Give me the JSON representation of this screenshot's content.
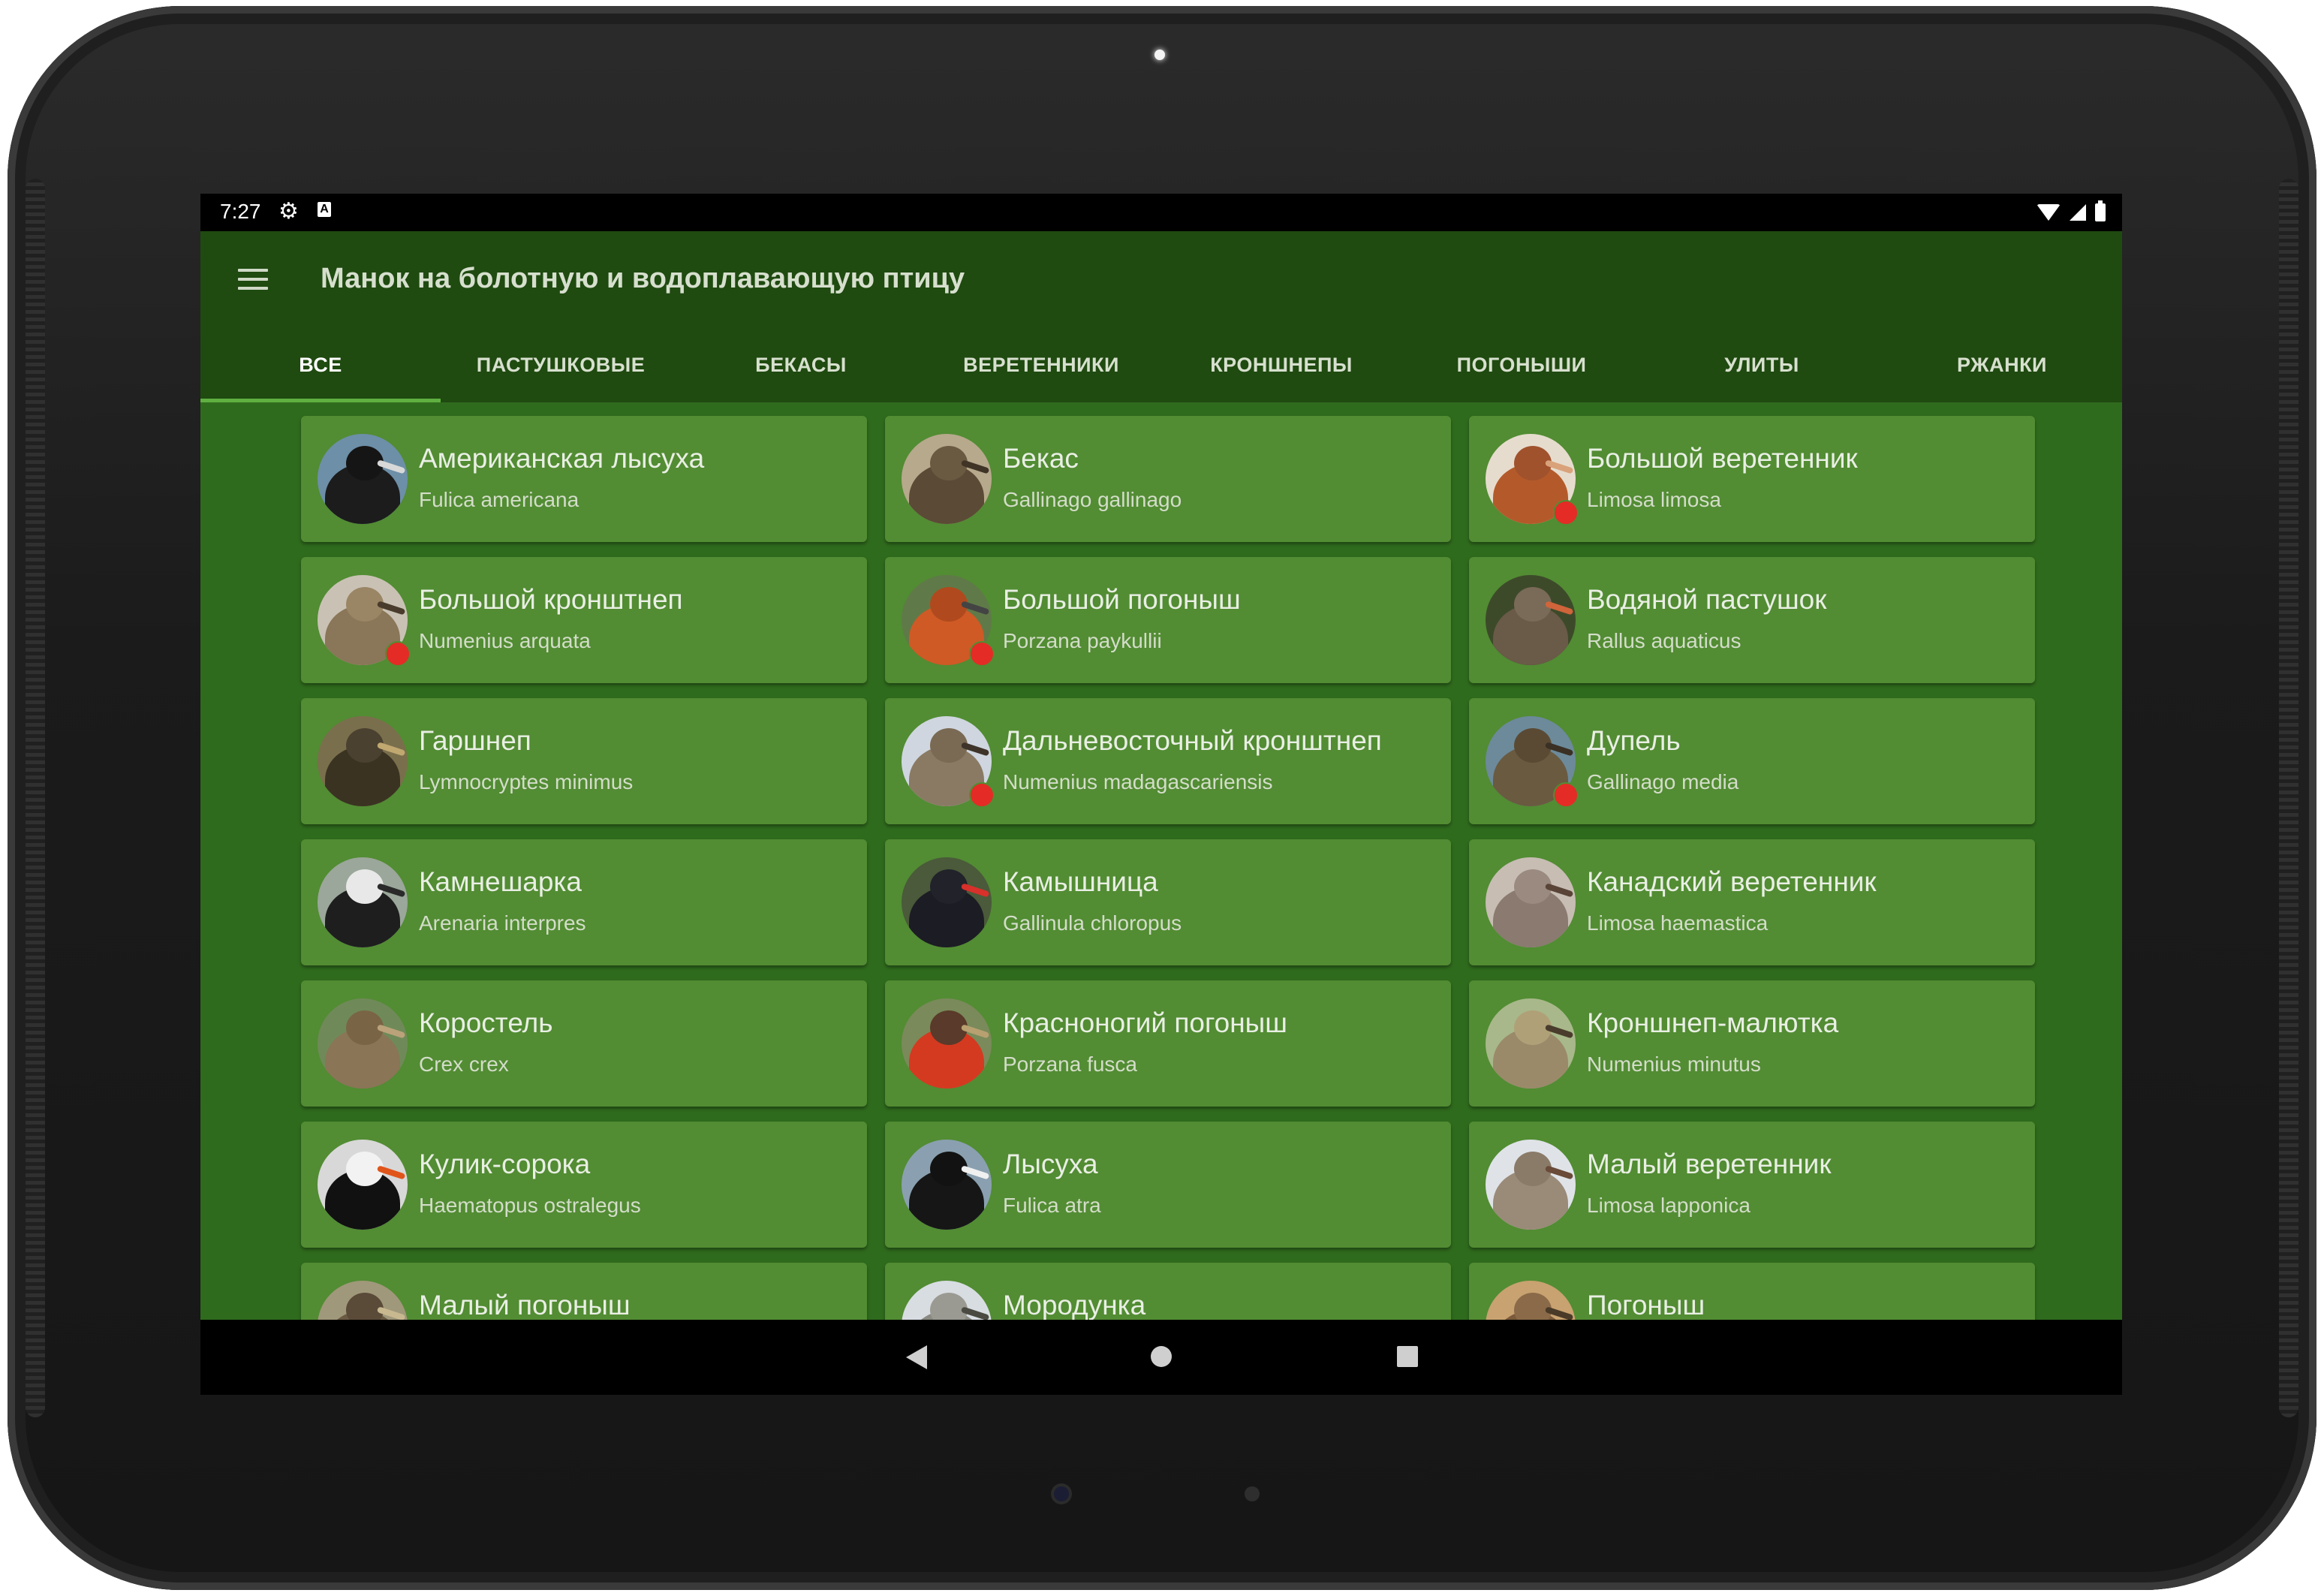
{
  "status": {
    "time": "7:27"
  },
  "app": {
    "title": "Манок на болотную и водоплавающую птицу"
  },
  "tabs": [
    {
      "label": "ВСЕ"
    },
    {
      "label": "ПАСТУШКОВЫЕ"
    },
    {
      "label": "БЕКАСЫ"
    },
    {
      "label": "ВЕРЕТЕННИКИ"
    },
    {
      "label": "КРОНШНЕПЫ"
    },
    {
      "label": "ПОГОНЫШИ"
    },
    {
      "label": "УЛИТЫ"
    },
    {
      "label": "РЖАНКИ"
    }
  ],
  "birds": [
    {
      "name": "Американская лысуха",
      "latin": "Fulica americana",
      "marked": false,
      "colors": [
        "#6d8fa8",
        "#1c1c1c",
        "#151515",
        "#d8d8d8"
      ]
    },
    {
      "name": "Бекас",
      "latin": "Gallinago gallinago",
      "marked": false,
      "colors": [
        "#b7a98c",
        "#5b4a36",
        "#6b5a42",
        "#3f3426"
      ]
    },
    {
      "name": "Большой веретенник",
      "latin": "Limosa limosa",
      "marked": true,
      "colors": [
        "#e6dccd",
        "#b45a2a",
        "#a0522d",
        "#d9a27a"
      ]
    },
    {
      "name": "Большой кронштнеп",
      "latin": "Numenius arquata",
      "marked": true,
      "colors": [
        "#c9c2b4",
        "#8a7658",
        "#9a8565",
        "#4a3c2c"
      ]
    },
    {
      "name": "Большой погоныш",
      "latin": "Porzana paykullii",
      "marked": true,
      "colors": [
        "#5f7a48",
        "#cf5a25",
        "#b04a1e",
        "#444444"
      ]
    },
    {
      "name": "Водяной пастушок",
      "latin": "Rallus aquaticus",
      "marked": false,
      "colors": [
        "#3d4a2a",
        "#6a5a48",
        "#7a6a58",
        "#d0643a"
      ]
    },
    {
      "name": "Гаршнеп",
      "latin": "Lymnocryptes minimus",
      "marked": false,
      "colors": [
        "#7a6f4c",
        "#3a3322",
        "#4a4130",
        "#c0a870"
      ]
    },
    {
      "name": "Дальневосточный кронштнеп",
      "latin": "Numenius madagascariensis",
      "marked": true,
      "colors": [
        "#cfd6df",
        "#8a7a64",
        "#7a6a54",
        "#3e342a"
      ]
    },
    {
      "name": "Дупель",
      "latin": "Gallinago media",
      "marked": true,
      "colors": [
        "#6c8a9a",
        "#6a5a40",
        "#5a4a34",
        "#3a3024"
      ]
    },
    {
      "name": "Камнешарка",
      "latin": "Arenaria interpres",
      "marked": false,
      "colors": [
        "#9aa79a",
        "#1e1e1e",
        "#e8e8e8",
        "#2a2a2a"
      ]
    },
    {
      "name": "Камышница",
      "latin": "Gallinula chloropus",
      "marked": false,
      "colors": [
        "#4a5a3a",
        "#1c1c24",
        "#22222a",
        "#d8302a"
      ]
    },
    {
      "name": "Канадский веретенник",
      "latin": "Limosa haemastica",
      "marked": false,
      "colors": [
        "#c7bdb3",
        "#8a7a70",
        "#9a8a80",
        "#5a4438"
      ]
    },
    {
      "name": "Коростель",
      "latin": "Crex crex",
      "marked": false,
      "colors": [
        "#6f8a58",
        "#8a7556",
        "#7a6446",
        "#bba27a"
      ]
    },
    {
      "name": "Красноногий погоныш",
      "latin": "Porzana fusca",
      "marked": false,
      "colors": [
        "#7a8a5a",
        "#d43a20",
        "#5a3a2a",
        "#b8a070"
      ]
    },
    {
      "name": "Кроншнеп-малютка",
      "latin": "Numenius minutus",
      "marked": false,
      "colors": [
        "#a8b88a",
        "#9a8a6a",
        "#b0a078",
        "#4a3c2c"
      ]
    },
    {
      "name": "Кулик-сорока",
      "latin": "Haematopus ostralegus",
      "marked": false,
      "colors": [
        "#d8d8d8",
        "#111111",
        "#f2f2f2",
        "#e0551a"
      ]
    },
    {
      "name": "Лысуха",
      "latin": "Fulica atra",
      "marked": false,
      "colors": [
        "#8aa0b0",
        "#161616",
        "#121212",
        "#f0f0f0"
      ]
    },
    {
      "name": "Малый веретенник",
      "latin": "Limosa lapponica",
      "marked": false,
      "colors": [
        "#dfe3e8",
        "#9a8a78",
        "#8a7a68",
        "#6a4a38"
      ]
    },
    {
      "name": "Малый погоныш",
      "latin": "",
      "marked": false,
      "colors": [
        "#a0987a",
        "#6a5a44",
        "#5a4a38",
        "#c8b890"
      ]
    },
    {
      "name": "Мородунка",
      "latin": "",
      "marked": false,
      "colors": [
        "#d8dde2",
        "#8a8a82",
        "#9a9a92",
        "#4a4a42"
      ]
    },
    {
      "name": "Погоныш",
      "latin": "",
      "marked": false,
      "colors": [
        "#c8a270",
        "#7a5a3a",
        "#8a6a48",
        "#4a3a28"
      ]
    }
  ]
}
